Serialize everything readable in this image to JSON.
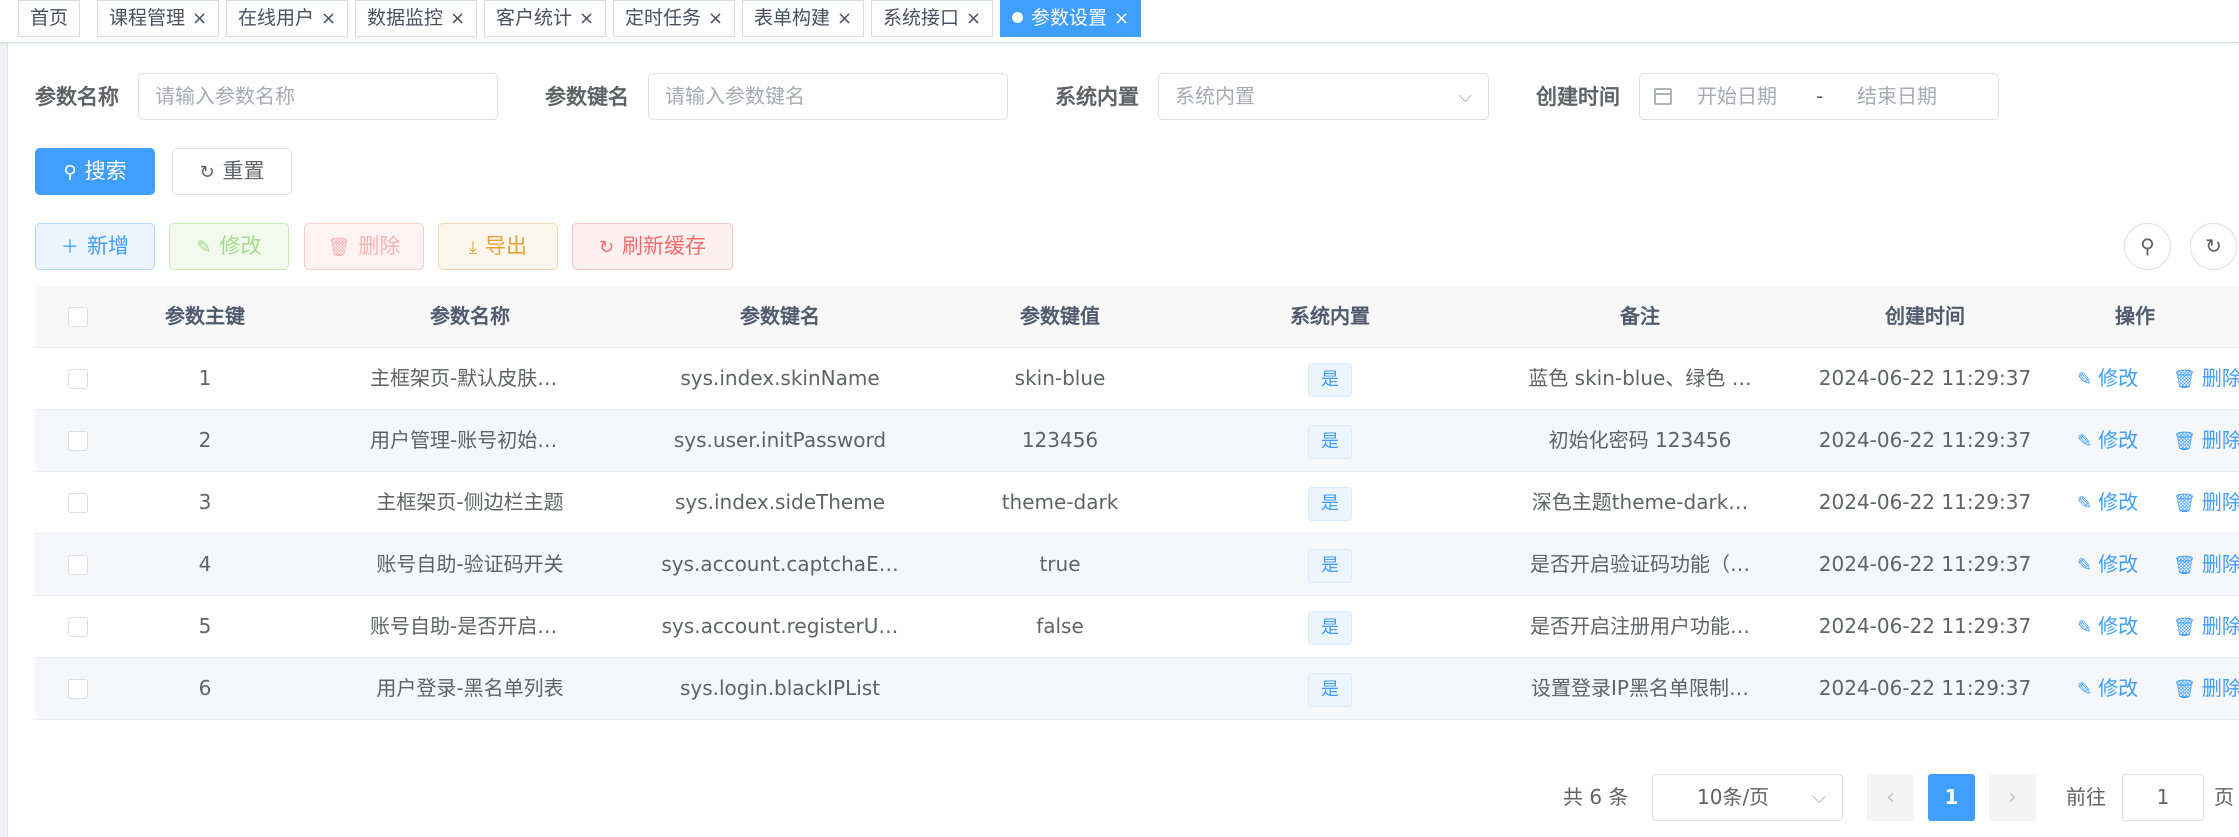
{
  "tags": [
    {
      "label": "首页",
      "closable": false,
      "active": false
    },
    {
      "label": "课程管理",
      "closable": true,
      "active": false
    },
    {
      "label": "在线用户",
      "closable": true,
      "active": false
    },
    {
      "label": "数据监控",
      "closable": true,
      "active": false
    },
    {
      "label": "客户统计",
      "closable": true,
      "active": false
    },
    {
      "label": "定时任务",
      "closable": true,
      "active": false
    },
    {
      "label": "表单构建",
      "closable": true,
      "active": false
    },
    {
      "label": "系统接口",
      "closable": true,
      "active": false
    },
    {
      "label": "参数设置",
      "closable": true,
      "active": true
    }
  ],
  "search": {
    "config_name_label": "参数名称",
    "config_name_placeholder": "请输入参数名称",
    "config_key_label": "参数键名",
    "config_key_placeholder": "请输入参数键名",
    "config_type_label": "系统内置",
    "config_type_placeholder": "系统内置",
    "create_time_label": "创建时间",
    "start_placeholder": "开始日期",
    "range_separator": "-",
    "end_placeholder": "结束日期",
    "search_button": "搜索",
    "reset_button": "重置"
  },
  "toolbar": {
    "add": "新增",
    "edit": "修改",
    "delete": "删除",
    "export": "导出",
    "refresh_cache": "刷新缓存"
  },
  "table": {
    "headers": [
      "参数主键",
      "参数名称",
      "参数键名",
      "参数键值",
      "系统内置",
      "备注",
      "创建时间",
      "操作"
    ],
    "rows": [
      {
        "id": "1",
        "name": "主框架页-默认皮肤样…",
        "key": "sys.index.skinName",
        "value": "skin-blue",
        "type": "是",
        "remark": "蓝色 skin-blue、绿色 …",
        "time": "2024-06-22 11:29:37"
      },
      {
        "id": "2",
        "name": "用户管理-账号初始密码",
        "key": "sys.user.initPassword",
        "value": "123456",
        "type": "是",
        "remark": "初始化密码 123456",
        "time": "2024-06-22 11:29:37"
      },
      {
        "id": "3",
        "name": "主框架页-侧边栏主题",
        "key": "sys.index.sideTheme",
        "value": "theme-dark",
        "type": "是",
        "remark": "深色主题theme-dark…",
        "time": "2024-06-22 11:29:37"
      },
      {
        "id": "4",
        "name": "账号自助-验证码开关",
        "key": "sys.account.captchaE…",
        "value": "true",
        "type": "是",
        "remark": "是否开启验证码功能（…",
        "time": "2024-06-22 11:29:37"
      },
      {
        "id": "5",
        "name": "账号自助-是否开启用…",
        "key": "sys.account.registerU…",
        "value": "false",
        "type": "是",
        "remark": "是否开启注册用户功能…",
        "time": "2024-06-22 11:29:37"
      },
      {
        "id": "6",
        "name": "用户登录-黑名单列表",
        "key": "sys.login.blackIPList",
        "value": "",
        "type": "是",
        "remark": "设置登录IP黑名单限制…",
        "time": "2024-06-22 11:29:37"
      }
    ],
    "edit_label": "修改",
    "delete_label": "删除"
  },
  "pagination": {
    "total_text": "共 6 条",
    "page_size": "10条/页",
    "current_page": "1",
    "goto_label": "前往",
    "goto_value": "1",
    "page_suffix": "页"
  },
  "colors": {
    "primary": "#409eff",
    "success": "#67c23a",
    "danger": "#f56c6c",
    "warning": "#e6a23c"
  }
}
